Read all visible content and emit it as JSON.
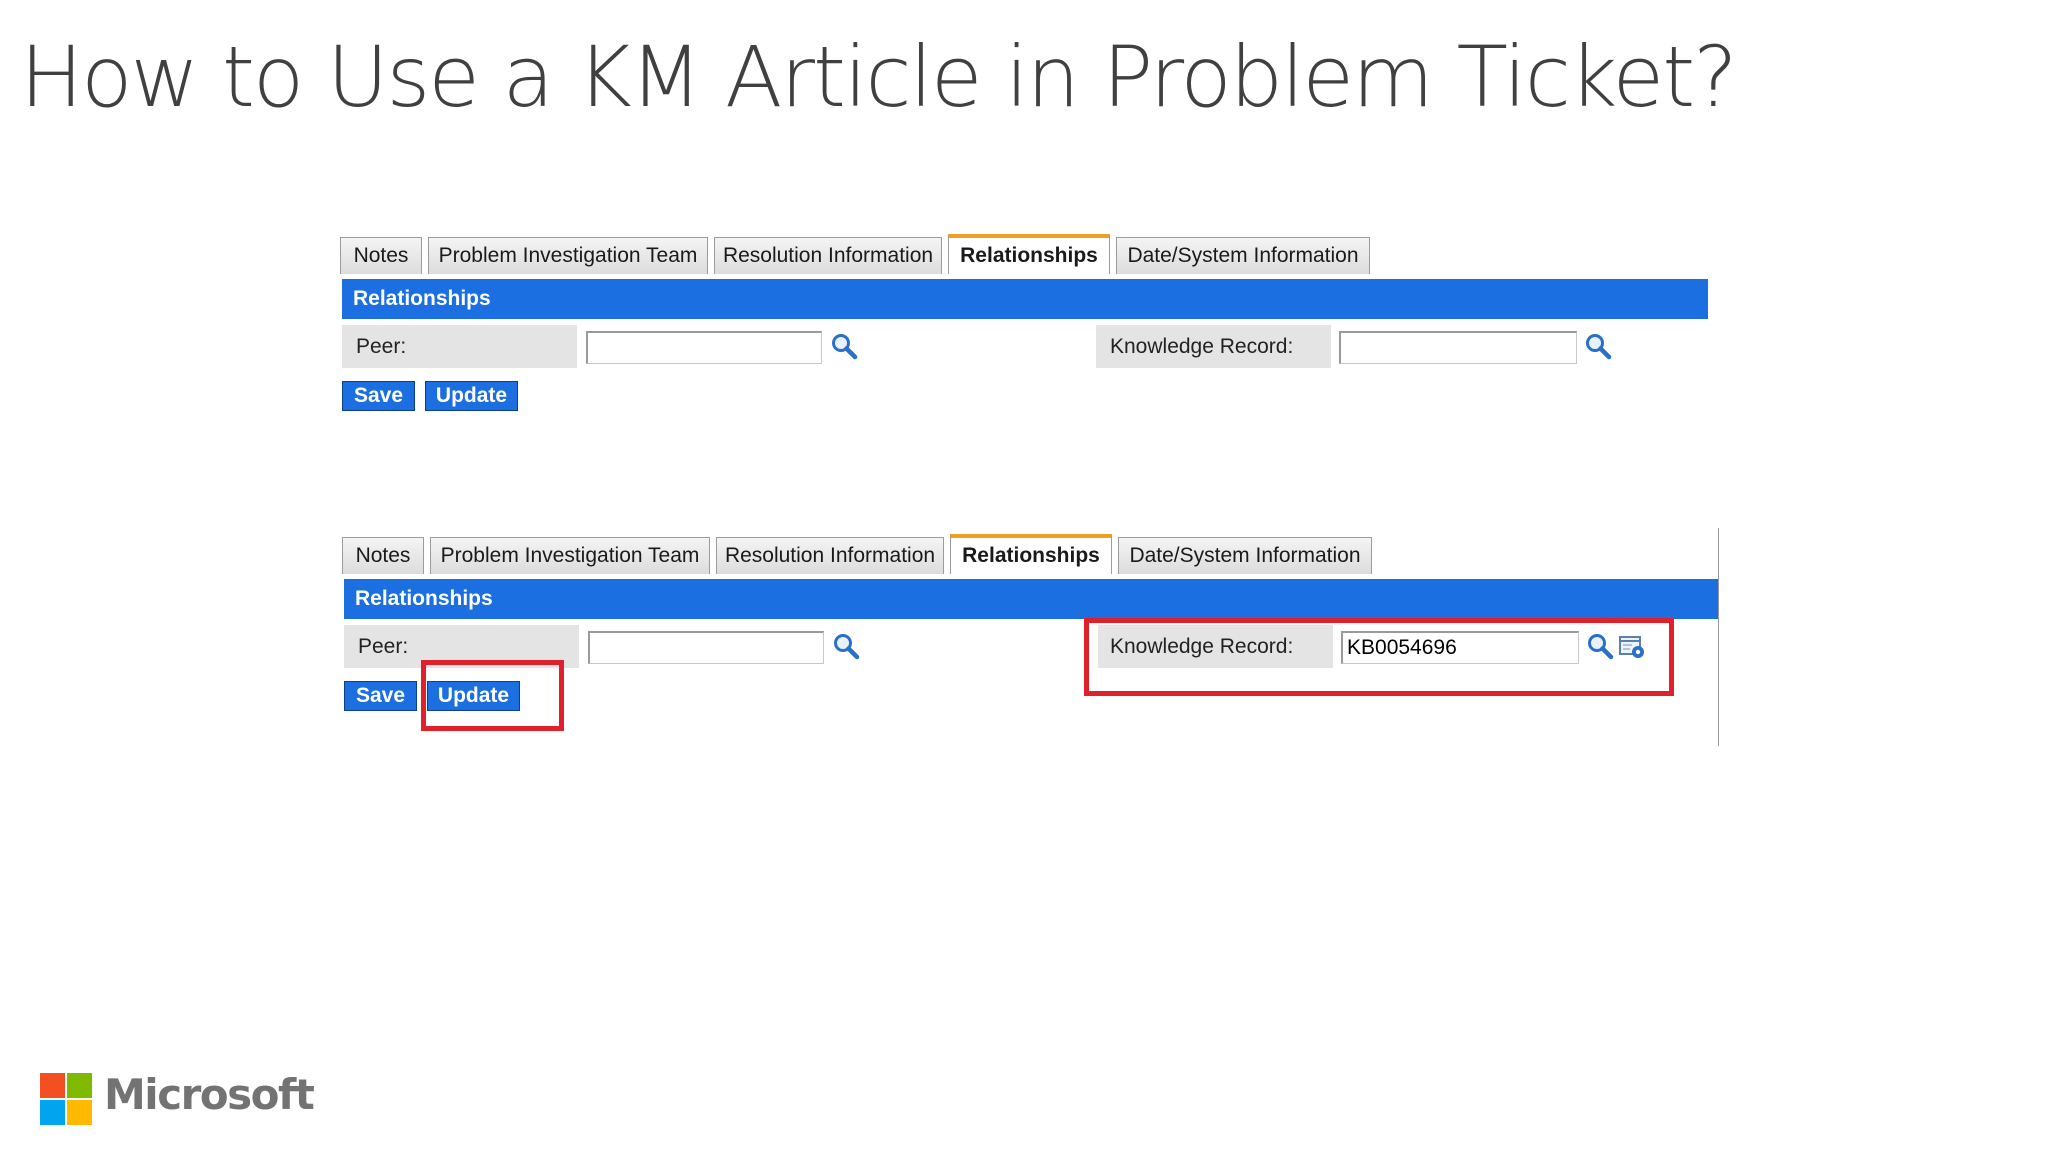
{
  "slide": {
    "title": "How to Use a KM Article in Problem Ticket?"
  },
  "before": {
    "tabs": [
      {
        "label": "Notes",
        "active": false
      },
      {
        "label": "Problem Investigation Team",
        "active": false
      },
      {
        "label": "Resolution Information",
        "active": false
      },
      {
        "label": "Relationships",
        "active": true
      },
      {
        "label": "Date/System Information",
        "active": false
      }
    ],
    "section_title": "Relationships",
    "peer_label": "Peer:",
    "peer_value": "",
    "knowledge_label": "Knowledge Record:",
    "knowledge_value": "",
    "save_label": "Save",
    "update_label": "Update"
  },
  "after": {
    "tabs": [
      {
        "label": "Notes",
        "active": false
      },
      {
        "label": "Problem Investigation Team",
        "active": false
      },
      {
        "label": "Resolution Information",
        "active": false
      },
      {
        "label": "Relationships",
        "active": true
      },
      {
        "label": "Date/System Information",
        "active": false
      }
    ],
    "section_title": "Relationships",
    "peer_label": "Peer:",
    "peer_value": "",
    "knowledge_label": "Knowledge Record:",
    "knowledge_value": "KB0054696",
    "save_label": "Save",
    "update_label": "Update"
  },
  "brand": {
    "name": "Microsoft"
  },
  "colors": {
    "section_bar": "#1c6fe0",
    "button": "#1c6fe0",
    "active_tab_accent": "#f0a020",
    "highlight": "#e0202a",
    "required_marker": "#2fb52f",
    "ms_red": "#f25022",
    "ms_green": "#7fba00",
    "ms_blue": "#00a4ef",
    "ms_yellow": "#ffb900"
  },
  "icons": [
    "search-icon",
    "lookup-icon",
    "microsoft-logo-icon"
  ]
}
